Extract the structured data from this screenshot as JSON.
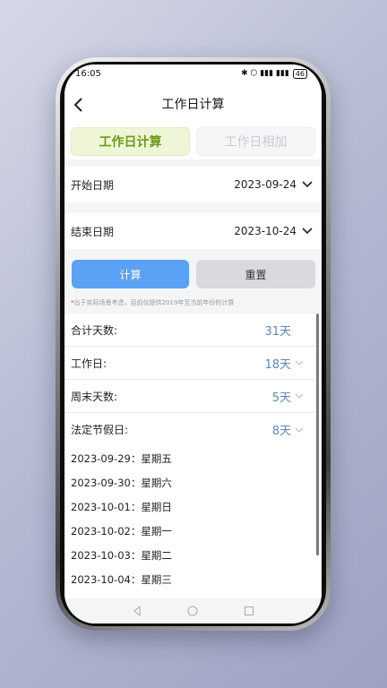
{
  "status_bar": {
    "time": "16:05",
    "right_icons": "✱ ⬡ ▮▮▮ ▮▮▮",
    "battery": "46"
  },
  "header": {
    "title": "工作日计算"
  },
  "tabs": {
    "active": "工作日计算",
    "inactive": "工作日相加"
  },
  "form": {
    "start_label": "开始日期",
    "start_value": "2023-09-24",
    "end_label": "结束日期",
    "end_value": "2023-10-24"
  },
  "buttons": {
    "calculate": "计算",
    "reset": "重置"
  },
  "note": "出于实际场景考虑，目前仅提供2019年至当前年份的计算",
  "results": [
    {
      "label": "合计天数:",
      "value": "31天",
      "expandable": false
    },
    {
      "label": "工作日:",
      "value": "18天",
      "expandable": true
    },
    {
      "label": "周末天数:",
      "value": "5天",
      "expandable": true
    },
    {
      "label": "法定节假日:",
      "value": "8天",
      "expandable": true
    }
  ],
  "holidays": [
    "2023-09-29：星期五",
    "2023-09-30：星期六",
    "2023-10-01：星期日",
    "2023-10-02：星期一",
    "2023-10-03：星期二",
    "2023-10-04：星期三"
  ],
  "colors": {
    "accent_green": "#6b9a15",
    "calc_button": "#5aa2f5",
    "value_blue": "#5b88b8"
  }
}
